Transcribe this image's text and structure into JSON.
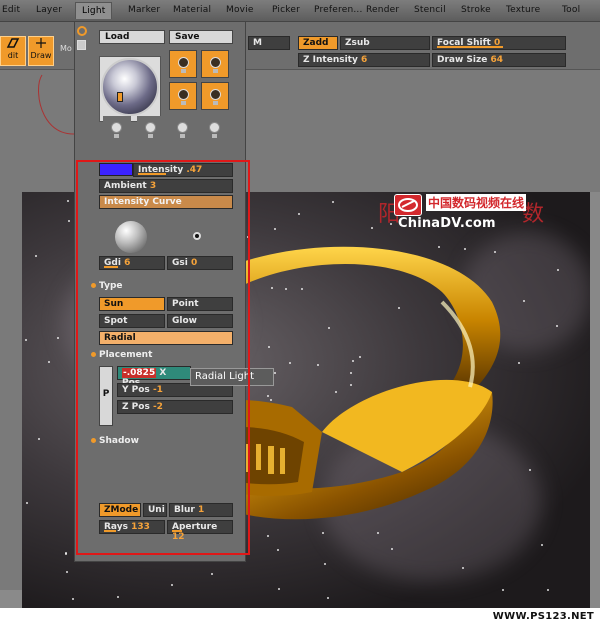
{
  "menu": {
    "items": [
      "Edit",
      "Layer",
      "Light",
      "Marker",
      "Material",
      "Movie",
      "Picker",
      "Preferen...",
      "Render",
      "Stencil",
      "Stroke",
      "Texture",
      "Tool"
    ],
    "active": "Light"
  },
  "toolbar": {
    "edit_label": "dit",
    "draw_label": "Draw",
    "move_label": "Mo",
    "m_label": "M",
    "zadd_label": "Zadd",
    "zsub_label": "Zsub",
    "focal_shift_label": "Focal Shift",
    "focal_shift_value": "0",
    "z_intensity_label": "Z Intensity",
    "z_intensity_value": "6",
    "draw_size_label": "Draw Size",
    "draw_size_value": "64"
  },
  "light_panel": {
    "load_label": "Load",
    "save_label": "Save",
    "intensity_label": "Intensity",
    "intensity_value": ".47",
    "ambient_label": "Ambient",
    "ambient_value": "3",
    "intensity_curve_label": "Intensity Curve",
    "gdi_label": "Gdi",
    "gdi_value": "6",
    "gsi_label": "Gsi",
    "gsi_value": "0",
    "type_section": "Type",
    "type_options": [
      "Sun",
      "Point",
      "Spot",
      "Glow",
      "Radial"
    ],
    "type_selected": "Sun",
    "placement_section": "Placement",
    "p_button_label": "P",
    "x_pos_value": "-.0825",
    "x_pos_label": "X Pos",
    "y_pos_label": "Y Pos",
    "y_pos_value": "-1",
    "z_pos_label": "Z Pos",
    "z_pos_value": "-2",
    "shadow_section": "Shadow",
    "zmode_label": "ZMode",
    "uni_label": "Uni",
    "blur_label": "Blur",
    "blur_value": "1",
    "rays_label": "Rays",
    "rays_value": "133",
    "aperture_label": "Aperture",
    "aperture_value": "12",
    "tooltip": "Radial Light"
  },
  "watermark": {
    "cn_text": "中国数码视频在线",
    "en_text": "ChinaDV.com"
  },
  "footer": {
    "url": "WWW.PS123.NET"
  },
  "colors": {
    "accent": "#f09a2a",
    "intensity_swatch": "#3b22ff",
    "highlight": "#e01818"
  }
}
